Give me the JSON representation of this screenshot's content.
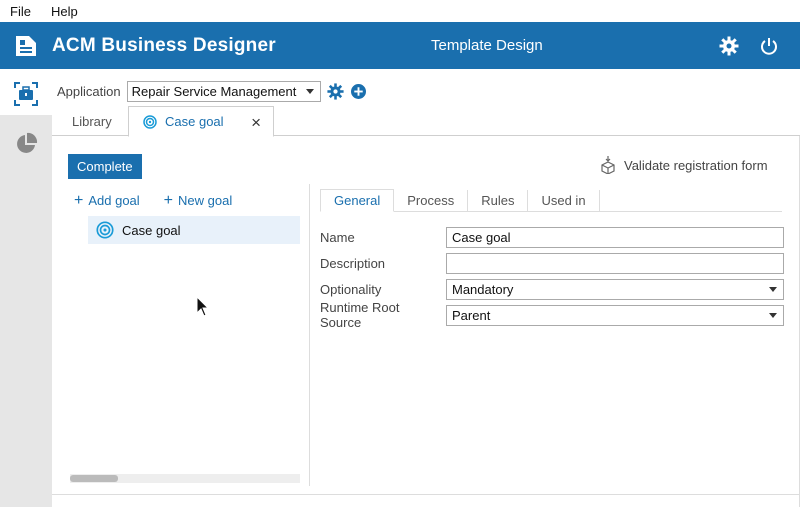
{
  "menu": {
    "file": "File",
    "help": "Help"
  },
  "header": {
    "app_title": "ACM Business Designer",
    "center_title": "Template Design",
    "brand_color": "#1a6fae"
  },
  "application": {
    "label": "Application",
    "selected": "Repair Service Management"
  },
  "tabs": {
    "library": "Library",
    "active": "Case goal"
  },
  "toolbar": {
    "complete": "Complete",
    "validate": "Validate registration form"
  },
  "goals": {
    "add_goal": "Add goal",
    "new_goal": "New goal",
    "items": [
      {
        "label": "Case goal"
      }
    ]
  },
  "details": {
    "tabs": [
      "General",
      "Process",
      "Rules",
      "Used in"
    ],
    "fields": {
      "name": {
        "label": "Name",
        "value": "Case goal"
      },
      "description": {
        "label": "Description",
        "value": ""
      },
      "optionality": {
        "label": "Optionality",
        "value": "Mandatory"
      },
      "runtime_root_source": {
        "label": "Runtime Root Source",
        "value": "Parent"
      }
    }
  }
}
